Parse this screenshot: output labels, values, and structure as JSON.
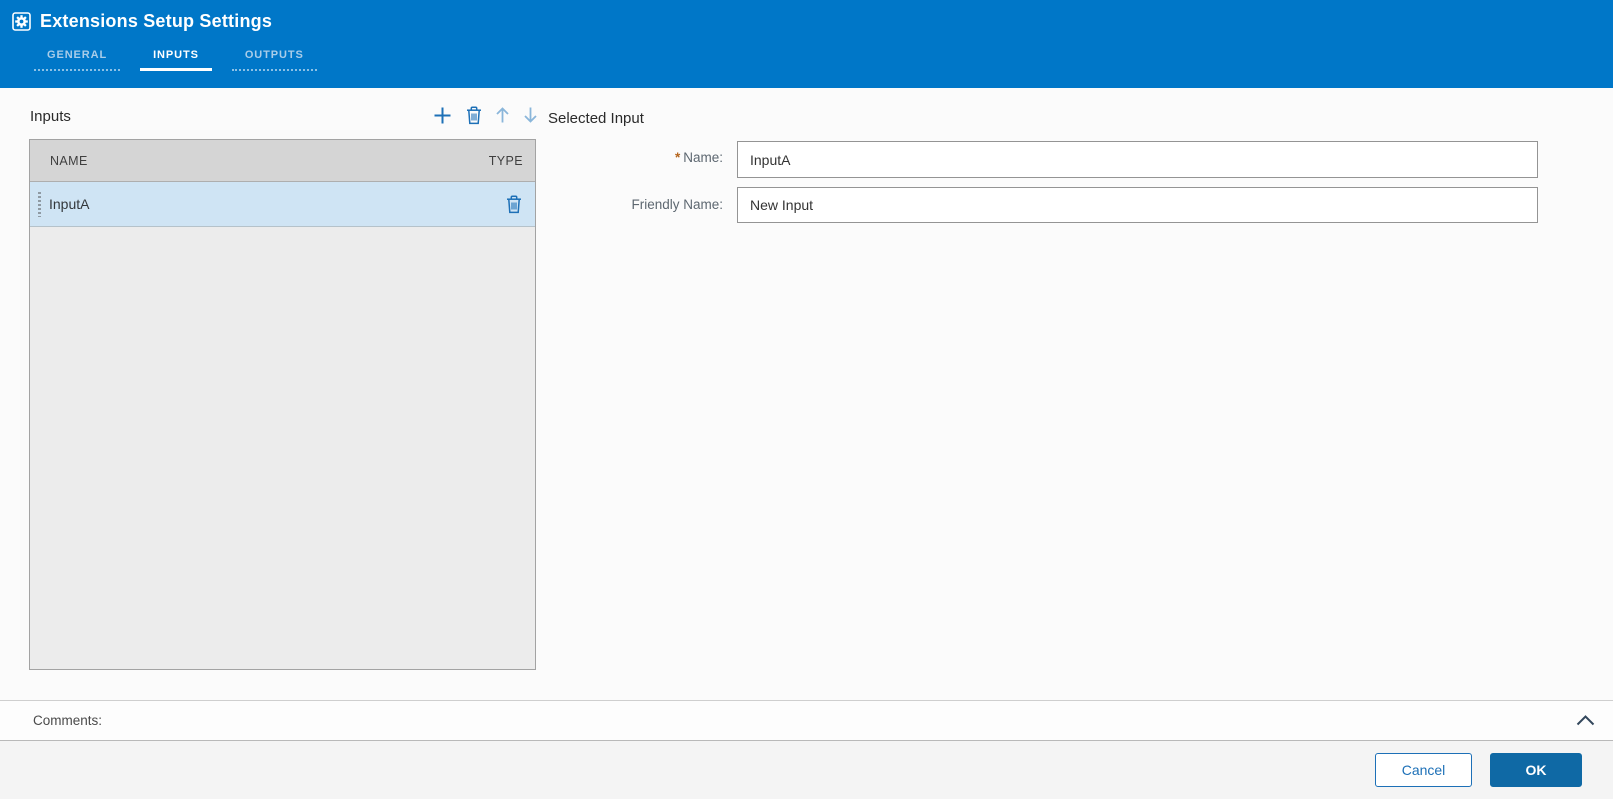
{
  "colors": {
    "header_blue": "#0077c8",
    "accent_blue": "#1d70b7",
    "disabled_arrow_blue": "#8ab6da",
    "ok_button_blue": "#0f69a5",
    "selected_row_blue": "#cfe4f4",
    "table_header_gray": "#d5d5d5",
    "required_asterisk": "#b5651d"
  },
  "header": {
    "title": "Extensions Setup Settings",
    "title_icon": "gear-in-square-icon",
    "tabs": [
      {
        "label": "GENERAL",
        "active": false
      },
      {
        "label": "INPUTS",
        "active": true
      },
      {
        "label": "OUTPUTS",
        "active": false
      }
    ]
  },
  "inputs_panel": {
    "title": "Inputs",
    "toolbar": [
      {
        "name": "add-icon"
      },
      {
        "name": "delete-icon"
      },
      {
        "name": "move-up-icon",
        "state": "disabled"
      },
      {
        "name": "move-down-icon",
        "state": "disabled"
      }
    ],
    "columns": [
      "NAME",
      "TYPE"
    ],
    "rows": [
      {
        "name": "InputA",
        "selected": true,
        "row_icons": [
          "drag-handle-icon",
          "delete-icon"
        ]
      }
    ]
  },
  "selected_input": {
    "title": "Selected Input",
    "required_marker": "*",
    "fields": [
      {
        "label": "Name:",
        "required": true,
        "value": "InputA"
      },
      {
        "label": "Friendly Name:",
        "required": false,
        "value": "New Input"
      }
    ]
  },
  "comments": {
    "label": "Comments:",
    "collapse_icon": "chevron-up-icon",
    "state": "expanded"
  },
  "footer": {
    "cancel_label": "Cancel",
    "ok_label": "OK"
  }
}
